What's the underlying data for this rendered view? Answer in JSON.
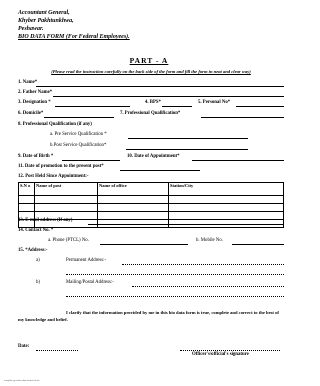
{
  "header": {
    "line1": "Accountant General,",
    "line2": "Khyber Pakhtunkhwa,",
    "line3": "Peshawar.",
    "line4": "BIO DATA FORM (For Federal Employees)."
  },
  "part_title": "PART - A",
  "instruction": "(Please read the instruction carefully on the back side of the form and fill the form in neat and clear way)",
  "fields": {
    "f1": "1. Name*",
    "f2": "2. Father Name*",
    "f3": "3. Designation *",
    "f4": "4. BPS*",
    "f5": "5. Personal No*",
    "f6": "6. Domicile*",
    "f7": "7. Professional Qualification*",
    "f8": "8. Professional Qualification (if any)",
    "f8a": "a. Pre Service Qualification *",
    "f8b": "b.Post Service Qualification*",
    "f9": "9. Date of Birth *",
    "f10": "10. Date of Appointment*",
    "f11": "11. Date of promotion to the present post*",
    "f12": "12. Post Held Since Appointment:-",
    "f13": "13. E-mail address (If any)",
    "f14": "14. Contact No. *",
    "f14a": "a. Phone (PTCL) No.",
    "f14b": "b. Mobile No.",
    "f15": "15. *Address:-",
    "f15a_label": "a)",
    "f15a": "Permanent Address:-",
    "f15b_label": "b)",
    "f15b": "Mailing/Postal Address:-"
  },
  "table": {
    "headers": [
      "S.N o",
      "Name of post",
      "Name of office",
      "Station/City"
    ],
    "rows": 4
  },
  "declaration": "I clarify that the information provided by me in this bio data form is true, complete and correct to the best of my knowledge and belief.",
  "date_label": "Date:",
  "signature_label": "Officer's/official's signature",
  "footer_text": "template.govt.bio.data.form.federal"
}
